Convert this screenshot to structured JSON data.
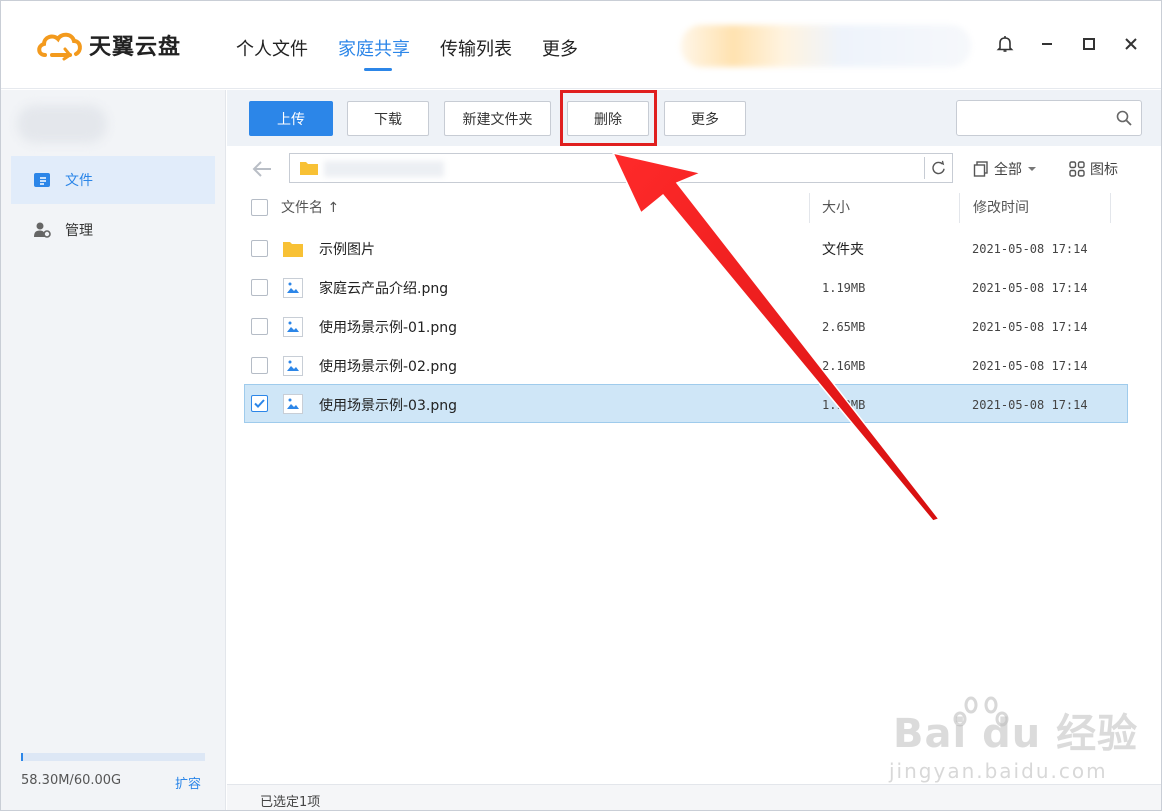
{
  "app": {
    "logo_text": "天翼云盘",
    "nav": [
      "个人文件",
      "家庭共享",
      "传输列表",
      "更多"
    ],
    "active_nav": "家庭共享"
  },
  "sidebar": {
    "items": [
      {
        "label": "文件",
        "icon": "file-icon",
        "active": true
      },
      {
        "label": "管理",
        "icon": "user-manage-icon",
        "active": false
      }
    ],
    "quota_text": "58.30M/60.00G",
    "quota_fraction": 0.001,
    "expand_label": "扩容"
  },
  "toolbar": {
    "upload": "上传",
    "download": "下载",
    "new_folder": "新建文件夹",
    "delete": "删除",
    "more": "更多",
    "search_placeholder": ""
  },
  "view": {
    "filter_label": "全部",
    "mode_label": "图标"
  },
  "table": {
    "headers": {
      "name": "文件名 ↑",
      "size": "大小",
      "modified": "修改时间"
    },
    "rows": [
      {
        "name": "示例图片",
        "type": "folder",
        "size": "文件夹",
        "modified": "2021-05-08 17:14",
        "checked": false
      },
      {
        "name": "家庭云产品介绍.png",
        "type": "image",
        "size": "1.19MB",
        "modified": "2021-05-08 17:14",
        "checked": false
      },
      {
        "name": "使用场景示例-01.png",
        "type": "image",
        "size": "2.65MB",
        "modified": "2021-05-08 17:14",
        "checked": false
      },
      {
        "name": "使用场景示例-02.png",
        "type": "image",
        "size": "2.16MB",
        "modified": "2021-05-08 17:14",
        "checked": false
      },
      {
        "name": "使用场景示例-03.png",
        "type": "image",
        "size": "1.93MB",
        "modified": "2021-05-08 17:14",
        "checked": true
      }
    ]
  },
  "status": {
    "selected_text": "已选定1项"
  },
  "watermark": {
    "main": "Bai du 经验",
    "sub": "jingyan.baidu.com"
  },
  "colors": {
    "accent": "#2c86e8",
    "highlight": "#e01f1f",
    "selected_row": "#cfe6f7"
  }
}
